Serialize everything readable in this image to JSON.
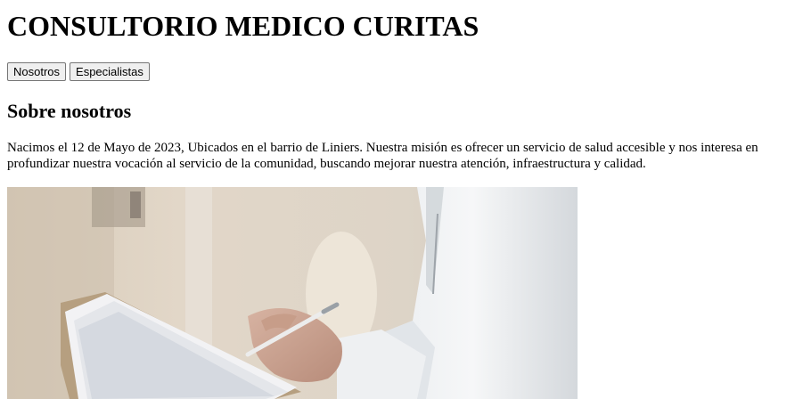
{
  "header": {
    "title": "CONSULTORIO MEDICO CURITAS"
  },
  "nav": {
    "items": [
      {
        "label": "Nosotros"
      },
      {
        "label": "Especialistas"
      }
    ]
  },
  "about": {
    "heading": "Sobre nosotros",
    "text": "Nacimos el 12 de Mayo de 2023, Ubicados en el barrio de Liniers. Nuestra misión es ofrecer un servicio de salud accesible y nos interesa en profundizar nuestra vocación al servicio de la comunidad, buscando mejorar nuestra atención, infraestructura y calidad."
  },
  "image": {
    "subject": "doctor-writing-on-clipboard"
  }
}
